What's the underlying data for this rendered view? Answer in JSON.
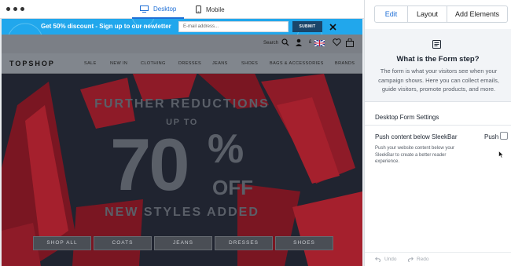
{
  "toolbar": {
    "tab_desktop": "Desktop",
    "tab_mobile": "Mobile",
    "active_tab": "desktop"
  },
  "sleekbar": {
    "message": "Get 50% discount - Sign up to our newletter",
    "email_placeholder": "E-mail address...",
    "submit_label": "SUBMIT",
    "background_color": "#21a7ec",
    "button_color": "#1a4569"
  },
  "site": {
    "search_label": "Search",
    "currency": "£",
    "logo": "TOPSHOP",
    "nav": [
      "SALE",
      "NEW IN",
      "CLOTHING",
      "DRESSES",
      "JEANS",
      "SHOES",
      "BAGS & ACCESSORIES",
      "BRANDS"
    ],
    "hero": {
      "line1": "FURTHER REDUCTIONS",
      "line2": "UP TO",
      "percent": "70",
      "percent_sign": "%",
      "off": "OFF",
      "line4": "NEW STYLES ADDED"
    },
    "categories": [
      "SHOP ALL",
      "COATS",
      "JEANS",
      "DRESSES",
      "SHOES"
    ]
  },
  "panel": {
    "tabs": [
      "Edit",
      "Layout",
      "Add Elements"
    ],
    "active_tab": "Edit",
    "info_title": "What is the Form step?",
    "info_text": "The form is what your visitors see when your campaign shows. Here you can collect emails, guide visitors, promote products, and more.",
    "settings_title": "Desktop Form Settings",
    "push_label": "Push content below SleekBar",
    "push_toggle_label": "Push",
    "push_checked": false,
    "push_description": "Push your website content below your SleekBar to create a better reader experience.",
    "undo_label": "Undo",
    "redo_label": "Redo"
  }
}
